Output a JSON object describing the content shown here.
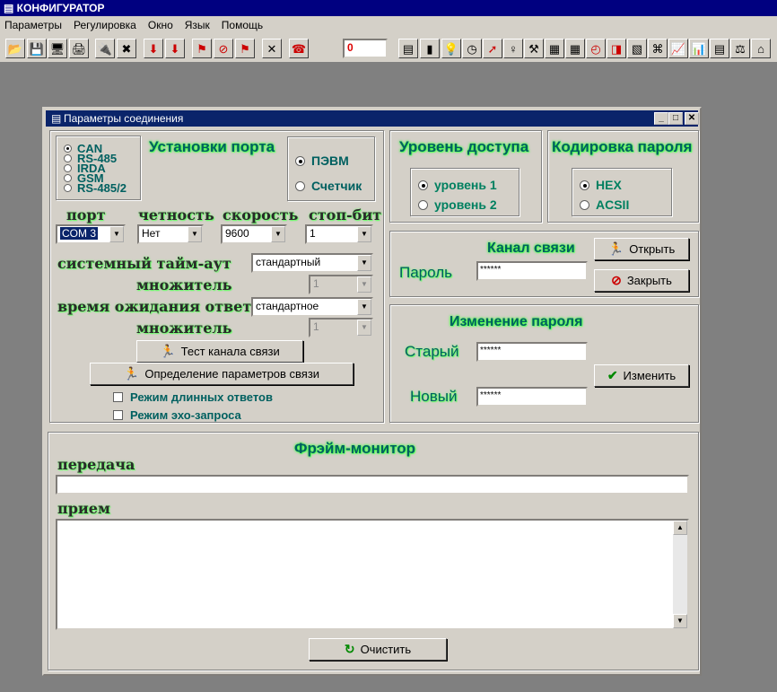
{
  "app": {
    "title": "КОНФИГУРАТОР"
  },
  "menu": [
    "Параметры",
    "Регулировка",
    "Окно",
    "Язык",
    "Помощь"
  ],
  "toolbar": {
    "counter_value": "0"
  },
  "dialog": {
    "title": "Параметры соединения",
    "port_settings": {
      "title": "Установки порта",
      "interfaces": [
        "CAN",
        "RS-485",
        "IRDA",
        "GSM",
        "RS-485/2"
      ],
      "selected_interface": "CAN",
      "target_options": [
        "ПЭВМ",
        "Счетчик"
      ],
      "selected_target": "ПЭВМ",
      "port_label": "порт",
      "port_value": "COM 3",
      "parity_label": "четность",
      "parity_value": "Нет",
      "speed_label": "скорость",
      "speed_value": "9600",
      "stopbit_label": "стоп-бит",
      "stopbit_value": "1",
      "sys_timeout_label": "системный тайм-аут",
      "sys_timeout_value": "стандартный",
      "multiplier_label": "множитель",
      "multiplier1_value": "1",
      "response_wait_label": "время ожидания ответа",
      "response_wait_value": "стандартное",
      "multiplier2_value": "1",
      "test_button": "Тест канала связи",
      "detect_button": "Определение параметров связи",
      "long_answers": "Режим длинных ответов",
      "echo_mode": "Режим эхо-запроса"
    },
    "access_level": {
      "title": "Уровень доступа",
      "options": [
        "уровень 1",
        "уровень 2"
      ],
      "selected": "уровень 1"
    },
    "password_encoding": {
      "title": "Кодировка пароля",
      "options": [
        "HEX",
        "ACSII"
      ],
      "selected": "HEX"
    },
    "channel": {
      "title": "Канал связи",
      "password_label": "Пароль",
      "password_value": "******",
      "open_button": "Открыть",
      "close_button": "Закрыть"
    },
    "change_password": {
      "title": "Изменение пароля",
      "old_label": "Старый",
      "old_value": "******",
      "new_label": "Новый",
      "new_value": "******",
      "change_button": "Изменить"
    },
    "frame_monitor": {
      "title": "Фрэйм-монитор",
      "transmit_label": "передача",
      "receive_label": "прием",
      "clear_button": "Очистить"
    }
  }
}
